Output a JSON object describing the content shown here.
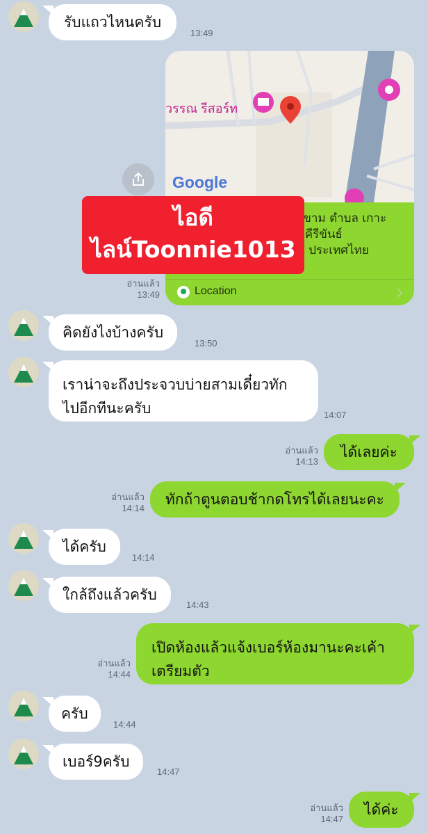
{
  "messages": [
    {
      "text": "รับแถวไหนครับ",
      "time": "13:49"
    },
    {
      "text": "คิดยังไงบ้างครับ",
      "time": "13:50"
    },
    {
      "line1": "เราน่าจะถึงประจวบบ่ายสามเดี๋ยวทัก",
      "line2": "ไปอีกทีนะครับ",
      "time": "14:07"
    },
    {
      "text": "ได้เลยค่ะ",
      "read": "อ่านแล้ว",
      "time": "14:13"
    },
    {
      "text": "ทักถ้าตูนตอบช้ากดโทรได้เลยนะคะ",
      "read": "อ่านแล้ว",
      "time": "14:14"
    },
    {
      "text": "ได้ครับ",
      "time": "14:14"
    },
    {
      "text": "ใกล้ถึงแล้วครับ",
      "time": "14:43"
    },
    {
      "line1": "เปิดห้องแล้วแจ้งเบอร์ห้องมานะคะเค้า",
      "line2": "เตรียมตัว",
      "read": "อ่านแล้ว",
      "time": "14:44"
    },
    {
      "text": "ครับ",
      "time": "14:44"
    },
    {
      "text": "เบอร์9ครับ",
      "time": "14:47"
    },
    {
      "text": "ได้ค่ะ",
      "read": "อ่านแล้ว",
      "time": "14:47"
    }
  ],
  "map_card": {
    "place_label": "วรรณ รีสอร์ท",
    "google_label": "Google",
    "address_line1": "งขาม ตำบล เกาะ",
    "address_line2": "บคีรีขันธ์",
    "address_line3": "0 ประเทศไทย",
    "location_label": "Location",
    "read": "อ่านแล้ว",
    "time": "13:49"
  },
  "promo": {
    "line1": "ไอดี",
    "line2": "ไลน์Toonnie1013"
  },
  "colors": {
    "background": "#c9d4e3",
    "outgoing_bubble": "#8ed630",
    "incoming_bubble": "#ffffff",
    "promo": "#f0202f"
  },
  "icons": [
    "avatar-mountain-icon",
    "share-icon",
    "map-pin-icon",
    "hotel-icon",
    "location-icon",
    "chevron-right-icon"
  ]
}
